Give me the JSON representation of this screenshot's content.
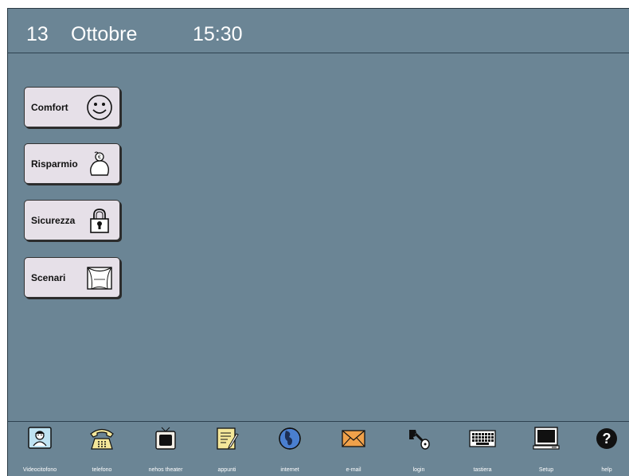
{
  "header": {
    "day": "13",
    "month": "Ottobre",
    "time": "15:30"
  },
  "menu": [
    {
      "label": "Comfort",
      "icon": "smiley-icon"
    },
    {
      "label": "Risparmio",
      "icon": "piggy-bank-icon"
    },
    {
      "label": "Sicurezza",
      "icon": "padlock-icon"
    },
    {
      "label": "Scenari",
      "icon": "theater-curtain-icon"
    }
  ],
  "dock": [
    {
      "label": "Videocitofono",
      "icon": "videointercom-icon"
    },
    {
      "label": "telefono",
      "icon": "telephone-icon"
    },
    {
      "label": "nehos theater",
      "icon": "tv-icon"
    },
    {
      "label": "appunti",
      "icon": "notepad-icon"
    },
    {
      "label": "internet",
      "icon": "globe-icon"
    },
    {
      "label": "e-mail",
      "icon": "envelope-icon"
    },
    {
      "label": "login",
      "icon": "key-icon"
    },
    {
      "label": "tastiera",
      "icon": "keyboard-icon"
    },
    {
      "label": "Setup",
      "icon": "monitor-icon"
    },
    {
      "label": "help",
      "icon": "help-icon"
    }
  ],
  "colors": {
    "background": "#6b8595",
    "button_face": "#e6e0e8"
  }
}
